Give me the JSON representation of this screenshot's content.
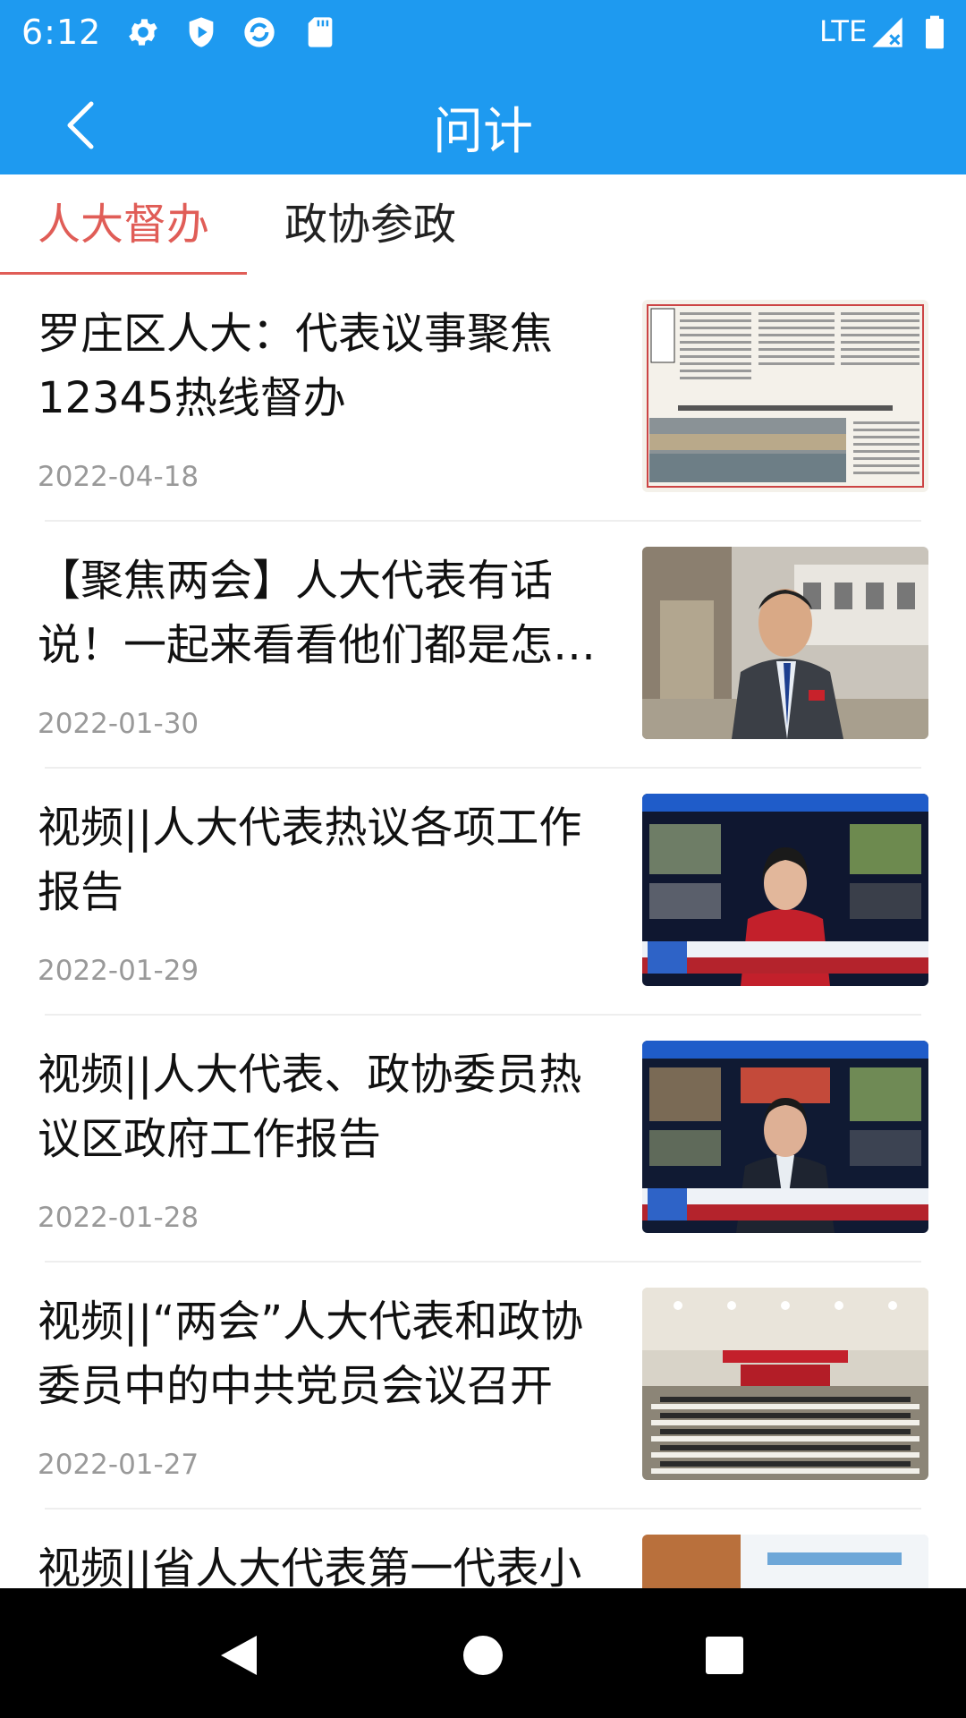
{
  "status_bar": {
    "time": "6:12",
    "network": "LTE",
    "icons": [
      "gear-icon",
      "shield-play-icon",
      "sync-icon",
      "sd-card-icon",
      "signal-icon",
      "battery-icon"
    ]
  },
  "app_bar": {
    "title": "问计",
    "back_icon": "back-arrow-icon"
  },
  "tabs": [
    {
      "label": "人大督办",
      "active": true
    },
    {
      "label": "政协参政",
      "active": false
    }
  ],
  "colors": {
    "primary": "#1e9af0",
    "accent": "#e05d57",
    "date_text": "#999999"
  },
  "articles": [
    {
      "title": "罗庄区人大：代表议事聚焦12345热线督办",
      "date": "2022-04-18",
      "thumb": "newspaper-page-image"
    },
    {
      "title": "【聚焦两会】人大代表有话说！一起来看看他们都是怎…",
      "date": "2022-01-30",
      "thumb": "delegate-portrait-image"
    },
    {
      "title": "视频||人大代表热议各项工作报告",
      "date": "2022-01-29",
      "thumb": "news-anchor-image"
    },
    {
      "title": "视频||人大代表、政协委员热议区政府工作报告",
      "date": "2022-01-28",
      "thumb": "news-anchor-image"
    },
    {
      "title": "视频||“两会”人大代表和政协委员中的中共党员会议召开",
      "date": "2022-01-27",
      "thumb": "meeting-hall-image"
    },
    {
      "title": "视频||省人大代表第一代表小",
      "date": "",
      "thumb": "conference-image"
    }
  ],
  "nav_bar": {
    "back": "nav-back-icon",
    "home": "nav-home-icon",
    "recents": "nav-recents-icon"
  }
}
